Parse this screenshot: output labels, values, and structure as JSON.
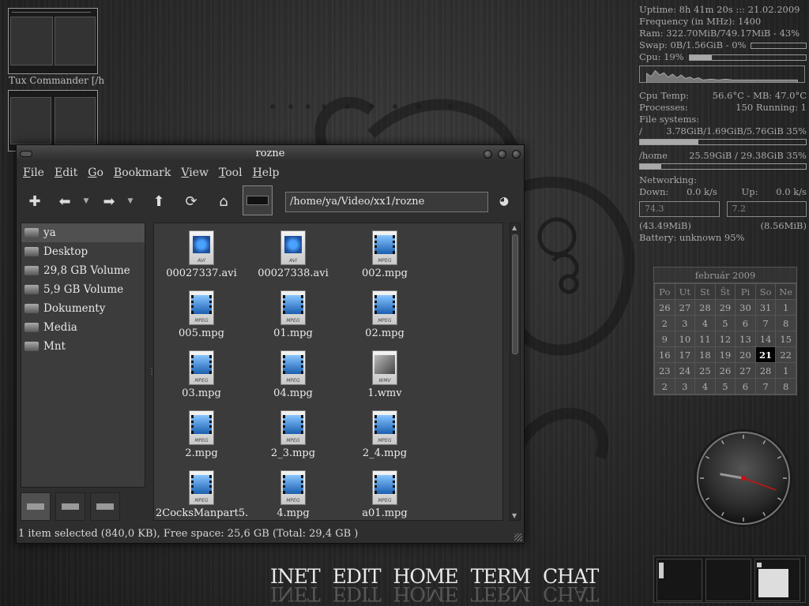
{
  "pager": {
    "label": "Tux Commander  [/h"
  },
  "conky": {
    "uptime": "Uptime: 8h 41m 20s ::: 21.02.2009",
    "frequency": "Frequency (in MHz): 1400",
    "ram": "Ram: 322.70MiB/749.17MiB -  43%",
    "ram_fraction": 0.43,
    "swap": "Swap: 0B/1.56GiB -   0%",
    "swap_fraction": 0.0,
    "cpu": "Cpu:  19%",
    "cpu_fraction": 0.19,
    "cpu_temp_label": "Cpu Temp:",
    "cpu_temp_value": "56.6°C - MB: 47.0°C",
    "processes_label": "Processes:",
    "processes_value": "150  Running: 1",
    "filesystems_label": "File systems:",
    "fs_root_label": "/",
    "fs_root_value": "3.78GiB/1.69GiB/5.76GiB  35%",
    "fs_root_fraction": 0.35,
    "fs_home_label": "/home",
    "fs_home_value": "25.59GiB / 29.38GiB  35%",
    "fs_home_fraction": 0.13,
    "networking_label": "Networking:",
    "down_label": "Down:",
    "down_value": "0.0 k/s",
    "up_label": "Up:",
    "up_value": "0.0 k/s",
    "down_graph": "74.3",
    "up_graph": "7.2",
    "down_total": "(43.49MiB)",
    "up_total": "(8.56MiB)",
    "battery": "Battery: unknown 95%"
  },
  "calendar": {
    "title": "február 2009",
    "days": [
      "Po",
      "Ut",
      "St",
      "Št",
      "Pi",
      "So",
      "Ne"
    ],
    "weeks": [
      [
        "26",
        "27",
        "28",
        "29",
        "30",
        "31",
        "1"
      ],
      [
        "2",
        "3",
        "4",
        "5",
        "6",
        "7",
        "8"
      ],
      [
        "9",
        "10",
        "11",
        "12",
        "13",
        "14",
        "15"
      ],
      [
        "16",
        "17",
        "18",
        "19",
        "20",
        "21",
        "22"
      ],
      [
        "23",
        "24",
        "25",
        "26",
        "27",
        "28",
        "1"
      ],
      [
        "2",
        "3",
        "4",
        "5",
        "6",
        "7",
        "8"
      ]
    ],
    "today": "21"
  },
  "clock": {
    "hour_hand_angle": 280,
    "minute_hand_angle": 110
  },
  "launcher": [
    "INET",
    "EDIT",
    "HOME",
    "TERM",
    "CHAT"
  ],
  "window": {
    "title": "rozne",
    "menu": [
      {
        "u": "F",
        "rest": "ile"
      },
      {
        "u": "E",
        "rest": "dit"
      },
      {
        "u": "G",
        "rest": "o"
      },
      {
        "u": "B",
        "rest": "ookmark"
      },
      {
        "u": "V",
        "rest": "iew"
      },
      {
        "u": "T",
        "rest": "ool"
      },
      {
        "u": "H",
        "rest": "elp"
      }
    ],
    "location": "/home/ya/Video/xx1/rozne",
    "places": [
      {
        "label": "ya",
        "icon": "home-icon"
      },
      {
        "label": "Desktop",
        "icon": "desktop-icon"
      },
      {
        "label": "29,8 GB Volume",
        "icon": "drive-icon"
      },
      {
        "label": "5,9 GB Volume",
        "icon": "drive-icon"
      },
      {
        "label": "Dokumenty",
        "icon": "folder-icon"
      },
      {
        "label": "Media",
        "icon": "folder-icon"
      },
      {
        "label": "Mnt",
        "icon": "folder-icon"
      }
    ],
    "files": [
      {
        "name": "00027337.avi",
        "type": "avi"
      },
      {
        "name": "00027338.avi",
        "type": "avi"
      },
      {
        "name": "002.mpg",
        "type": "mpeg"
      },
      {
        "name": "005.mpg",
        "type": "mpeg"
      },
      {
        "name": "01.mpg",
        "type": "mpeg"
      },
      {
        "name": "02.mpg",
        "type": "mpeg"
      },
      {
        "name": "03.mpg",
        "type": "mpeg"
      },
      {
        "name": "04.mpg",
        "type": "mpeg"
      },
      {
        "name": "1.wmv",
        "type": "wmv"
      },
      {
        "name": "2.mpg",
        "type": "mpeg"
      },
      {
        "name": "2_3.mpg",
        "type": "mpeg"
      },
      {
        "name": "2_4.mpg",
        "type": "mpeg"
      },
      {
        "name": "2CocksManpart5.",
        "type": "mpeg"
      },
      {
        "name": "4.mpg",
        "type": "mpeg"
      },
      {
        "name": "a01.mpg",
        "type": "mpeg"
      }
    ],
    "status": "1 item selected (840,0 KB), Free space: 25,6 GB (Total: 29,4 GB )"
  }
}
